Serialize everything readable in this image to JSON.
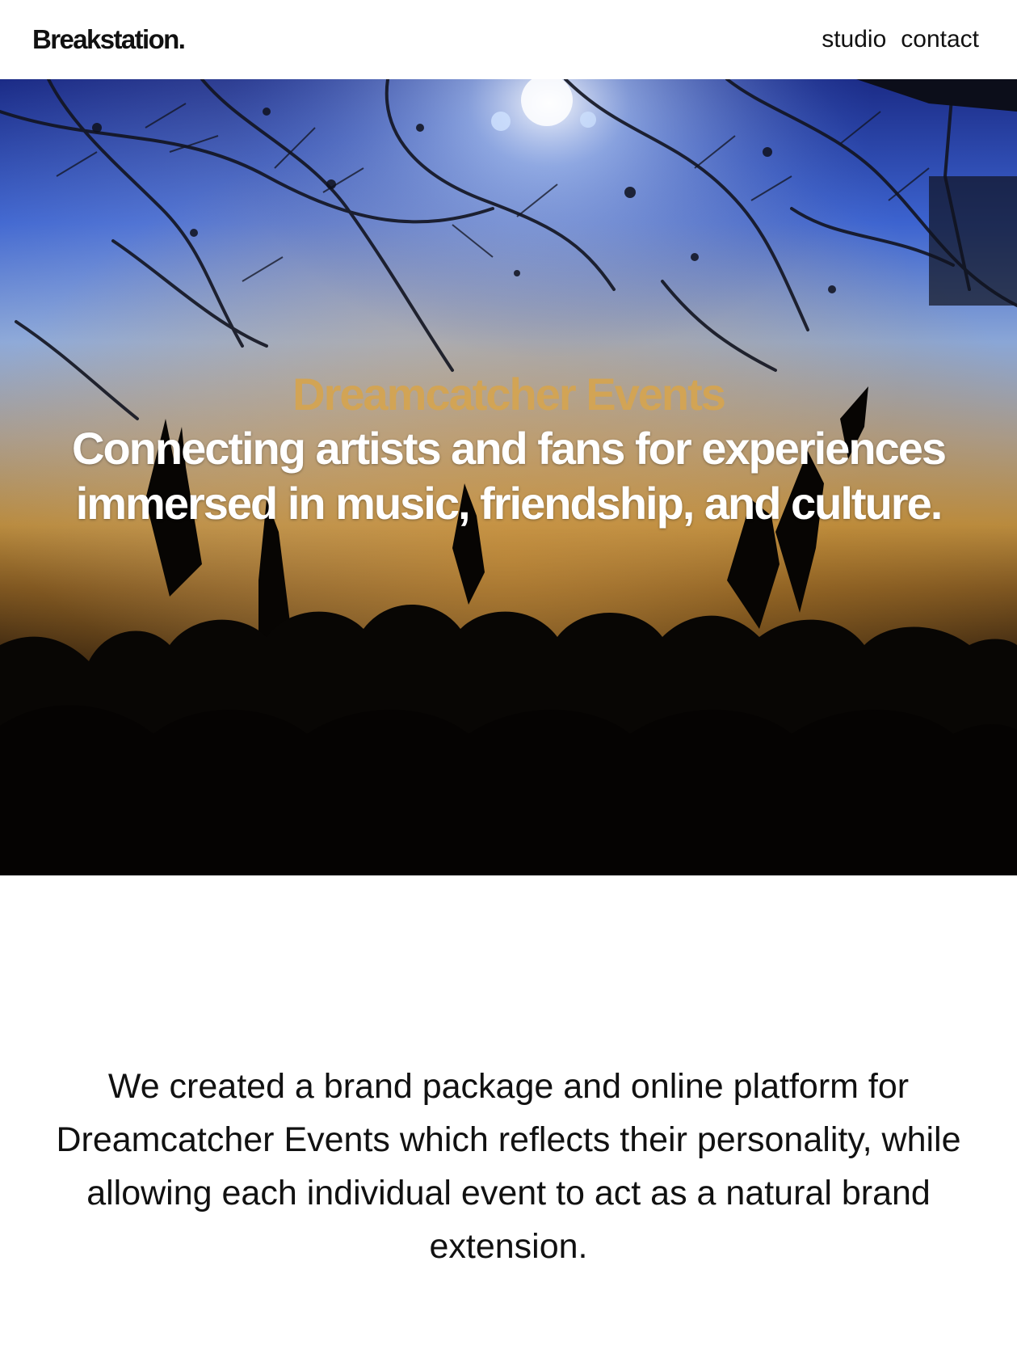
{
  "header": {
    "logo": "Breakstation.",
    "nav": {
      "studio": "studio",
      "contact": "contact"
    }
  },
  "hero": {
    "kicker": "Dreamcatcher Events",
    "headline": "Connecting artists and fans for experiences immersed in music, friendship, and culture.",
    "colors": {
      "kicker": "#d2a455",
      "headline": "#ffffff"
    }
  },
  "description": {
    "text": "We created a brand package and online platform for Dreamcatcher Events which reflects their personality, while allowing each individual event to act as a natural brand extension."
  }
}
